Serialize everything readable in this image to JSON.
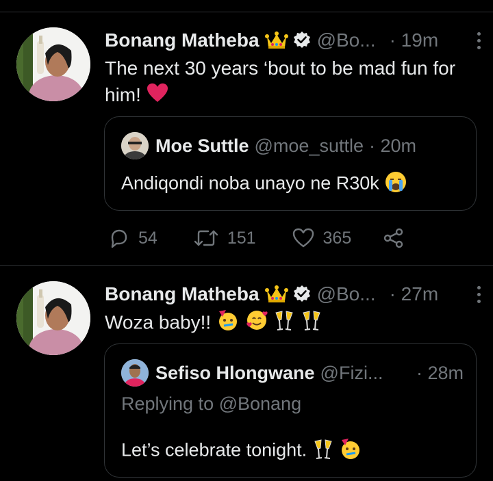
{
  "tweets": [
    {
      "author": "Bonang Matheba",
      "handle": "@Bo...",
      "time": "· 19m",
      "text": "The next 30 years ‘bout to be mad fun for him!",
      "quote": {
        "author": "Moe Suttle",
        "handle": "@moe_suttle",
        "time": "· 20m",
        "text": "Andiqondi noba unayo ne R30k"
      },
      "actions": {
        "replies": "54",
        "retweets": "151",
        "likes": "365"
      }
    },
    {
      "author": "Bonang Matheba",
      "handle": "@Bo...",
      "time": "· 27m",
      "text": "Woza baby!!",
      "quote": {
        "author": "Sefiso Hlongwane",
        "handle": "@Fizi...",
        "time": "· 28m",
        "replying": "Replying to @Bonang",
        "text": "Let’s celebrate tonight."
      }
    }
  ],
  "icons": [
    "crown-emoji",
    "verified-badge-icon",
    "more-icon",
    "heart-emoji",
    "crying-emoji",
    "reply-icon",
    "retweet-icon",
    "like-icon",
    "share-icon",
    "party-face-emoji",
    "hearts-face-emoji",
    "clinking-glasses-emoji"
  ],
  "colors": {
    "background": "#000000",
    "text": "#e7e9ea",
    "secondary": "#71767b",
    "border": "#2f3336",
    "heart": "#f91880"
  }
}
